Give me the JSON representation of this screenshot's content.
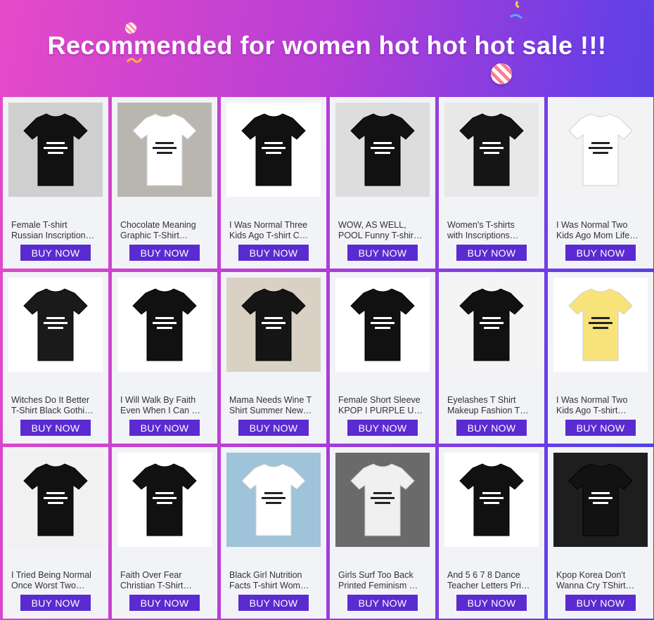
{
  "header": {
    "title": "Recommended for women hot hot hot sale !!!"
  },
  "button_label": "BUY NOW",
  "colors": {
    "bg_left": "#e64ac8",
    "bg_right": "#4a45e4",
    "button": "#5a2bd0",
    "card": "#f2f3f7"
  },
  "products": [
    {
      "line1": "Female T-shirt",
      "line2": "Russian Inscription…",
      "image": "woman-black-tee-photo",
      "shirt": "#111111",
      "bg": "#cfcfcf"
    },
    {
      "line1": "Chocolate Meaning",
      "line2": "Graphic T-Shirt…",
      "image": "white-tee-on-couch",
      "shirt": "#ffffff",
      "bg": "#b9b6b0"
    },
    {
      "line1": "I Was Normal Three",
      "line2": "Kids Ago T-shirt C…",
      "image": "black-tee-flatlay",
      "shirt": "#111111",
      "bg": "#ffffff"
    },
    {
      "line1": "WOW, AS WELL,",
      "line2": "POOL Funny T-shir…",
      "image": "women-black-tees-street",
      "shirt": "#111111",
      "bg": "#dddddd"
    },
    {
      "line1": "Women's T-shirts",
      "line2": "with Inscriptions…",
      "image": "black-tee-closeup",
      "shirt": "#151515",
      "bg": "#e8e8e8"
    },
    {
      "line1": "I Was Normal Two",
      "line2": "Kids Ago Mom Life…",
      "image": "white-tee-flatlay",
      "shirt": "#ffffff",
      "bg": "#f3f3f3"
    },
    {
      "line1": "Witches Do It Better",
      "line2": "T-Shirt Black Gothi…",
      "image": "woman-black-tee",
      "shirt": "#1a1a1a",
      "bg": "#ffffff"
    },
    {
      "line1": "I Will Walk By Faith",
      "line2": "Even When I Can …",
      "image": "black-tee-with-jeans",
      "shirt": "#111111",
      "bg": "#ffffff"
    },
    {
      "line1": "Mama Needs Wine T",
      "line2": "Shirt Summer New…",
      "image": "woman-black-tee-red-skirt",
      "shirt": "#151515",
      "bg": "#d9d1c4"
    },
    {
      "line1": "Female Short Sleeve",
      "line2": "KPOP I PURPLE U…",
      "image": "black-tee-grid-flatlay",
      "shirt": "#111111",
      "bg": "#ffffff"
    },
    {
      "line1": "Eyelashes T Shirt",
      "line2": "Makeup Fashion T…",
      "image": "black-tee-eyelashes",
      "shirt": "#111111",
      "bg": "#f4f4f4"
    },
    {
      "line1": "I Was Normal Two",
      "line2": "Kids Ago T-shirt…",
      "image": "yellow-tee-flatlay",
      "shirt": "#f7e37a",
      "bg": "#ffffff"
    },
    {
      "line1": "I Tried Being Normal",
      "line2": "Once Worst Two…",
      "image": "woman-black-crop-tee",
      "shirt": "#111111",
      "bg": "#f1f1f1"
    },
    {
      "line1": "Faith Over Fear",
      "line2": "Christian T-Shirt…",
      "image": "black-tee-faith",
      "shirt": "#111111",
      "bg": "#ffffff"
    },
    {
      "line1": "Black Girl Nutrition",
      "line2": "Facts T-shirt Wom…",
      "image": "woman-white-tee-nutrition",
      "shirt": "#ffffff",
      "bg": "#9fc3d8"
    },
    {
      "line1": "Girls Surf Too Back",
      "line2": "Printed Feminism …",
      "image": "woman-white-tee-back",
      "shirt": "#f0f0f0",
      "bg": "#6a6a6a"
    },
    {
      "line1": "And 5 6 7 8 Dance",
      "line2": "Teacher Letters Pri…",
      "image": "black-tee-hanger",
      "shirt": "#111111",
      "bg": "#ffffff"
    },
    {
      "line1": "Kpop Korea Don't",
      "line2": "Wanna Cry TShirt…",
      "image": "black-tee-kpop",
      "shirt": "#121212",
      "bg": "#1e1e1e"
    }
  ]
}
